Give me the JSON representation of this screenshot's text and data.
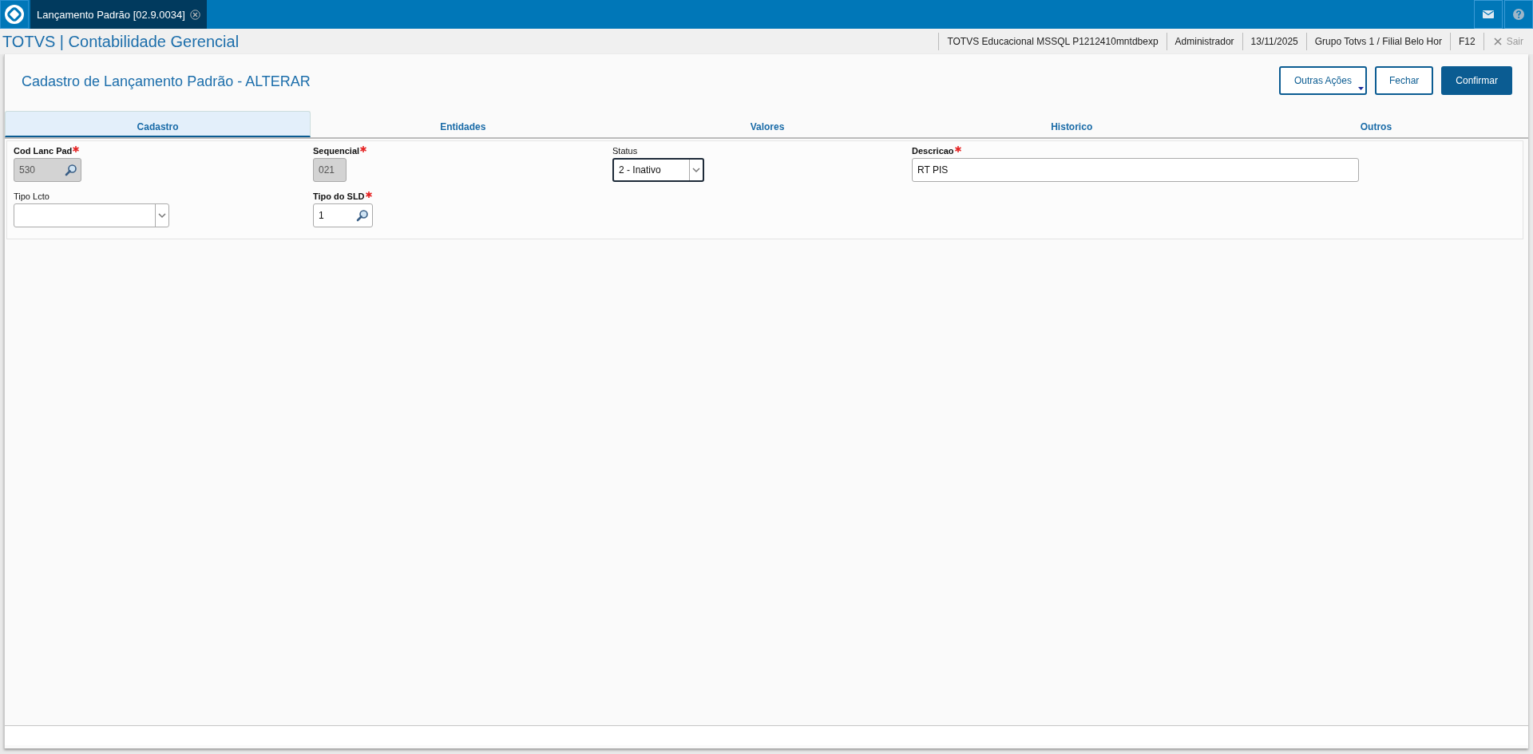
{
  "top_bar": {
    "tab": {
      "label": "Lançamento Padrão [02.9.0034]",
      "selected": true
    }
  },
  "header": {
    "app_title": "TOTVS | Contabilidade Gerencial",
    "info": [
      "TOTVS Educacional MSSQL P1212410mntdbexp",
      "Administrador",
      "13/11/2025",
      "Grupo Totvs 1 / Filial Belo Hor",
      "F12"
    ],
    "exit": "Sair"
  },
  "page": {
    "title": "Cadastro de Lançamento Padrão - ALTERAR",
    "buttons": [
      {
        "label": "Outras Ações",
        "kind": "menu"
      },
      {
        "label": "Fechar",
        "kind": "secondary"
      },
      {
        "label": "Confirmar",
        "kind": "primary"
      }
    ]
  },
  "tabs": [
    {
      "label": "Cadastro",
      "selected": true
    },
    {
      "label": "Entidades",
      "selected": false
    },
    {
      "label": "Valores",
      "selected": false
    },
    {
      "label": "Historico",
      "selected": false
    },
    {
      "label": "Outros",
      "selected": false
    }
  ],
  "form": {
    "rows": [
      [
        {
          "label": "Cod Lanc Pad",
          "required": true,
          "kind": "lookup",
          "value": "530",
          "disabled": true,
          "focused": false
        },
        {
          "label": "Sequencial",
          "required": true,
          "kind": "text",
          "value": "021",
          "disabled": true,
          "focused": false
        },
        {
          "label": "Status",
          "required": false,
          "kind": "select",
          "value": "2 - Inativo",
          "disabled": false,
          "focused": true
        },
        {
          "label": "Descricao",
          "required": true,
          "kind": "text",
          "value": "RT PIS",
          "disabled": false,
          "focused": false
        }
      ],
      [
        {
          "label": "Tipo Lcto",
          "required": false,
          "kind": "select",
          "disabled": false,
          "focused": false
        },
        {
          "label": "Tipo do SLD",
          "required": true,
          "kind": "lookup",
          "value": "1",
          "disabled": false,
          "focused": false
        }
      ]
    ]
  }
}
